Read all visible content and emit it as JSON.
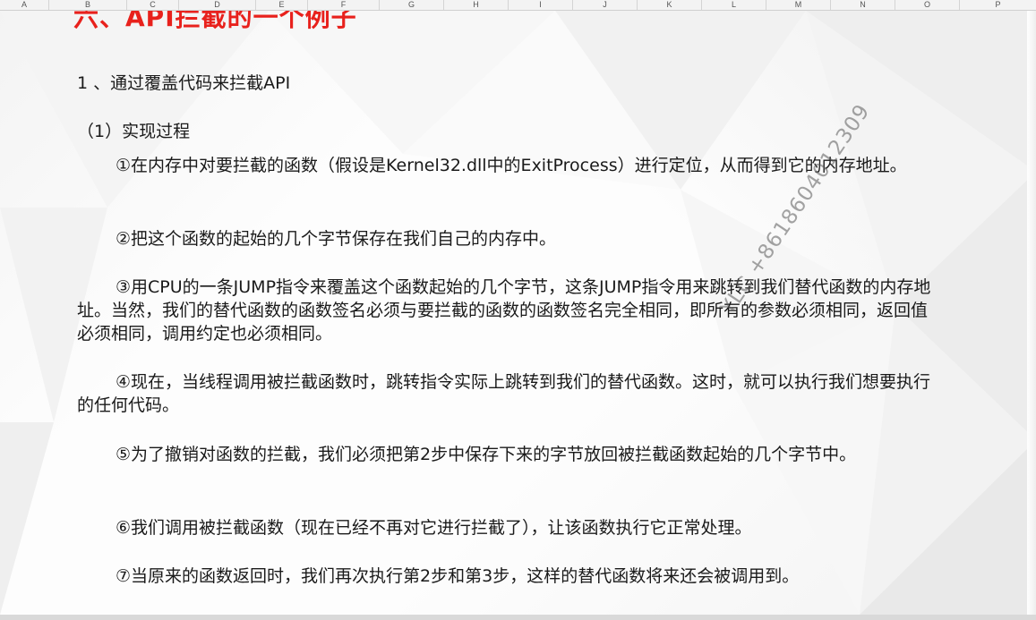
{
  "spreadsheet": {
    "columns": [
      "A",
      "B",
      "C",
      "D",
      "E",
      "F",
      "G",
      "H",
      "I",
      "J",
      "K",
      "L",
      "M",
      "N",
      "O",
      "P"
    ]
  },
  "slide": {
    "heading": "六、API拦截的一个例子",
    "subheading": "1 、通过覆盖代码来拦截API",
    "subsection": "（1）实现过程",
    "steps": [
      "①在内存中对要拦截的函数（假设是Kernel32.dll中的ExitProcess）进行定位，从而得到它的内存地址。",
      "②把这个函数的起始的几个字节保存在我们自己的内存中。",
      "③用CPU的一条JUMP指令来覆盖这个函数起始的几个字节，这条JUMP指令用来跳转到我们替代函数的内存地址。当然，我们的替代函数的函数签名必须与要拦截的函数的函数签名完全相同，即所有的参数必须相同，返回值必须相同，调用约定也必须相同。",
      "④现在，当线程调用被拦截函数时，跳转指令实际上跳转到我们的替代函数。这时，就可以执行我们想要执行的任何代码。",
      "⑤为了撤销对函数的拦截，我们必须把第2步中保存下来的字节放回被拦截函数起始的几个字节中。",
      "⑥我们调用被拦截函数（现在已经不再对它进行拦截了），让该函数执行它正常处理。",
      "⑦当原来的函数返回时，我们再次执行第2步和第3步，这样的替代函数将来还会被调用到。"
    ],
    "watermark": "YLC  +8618604012309"
  },
  "colors": {
    "heading": "#e8211c",
    "body_text": "#1a1a1a",
    "header_bg": "#f3f3f3"
  }
}
